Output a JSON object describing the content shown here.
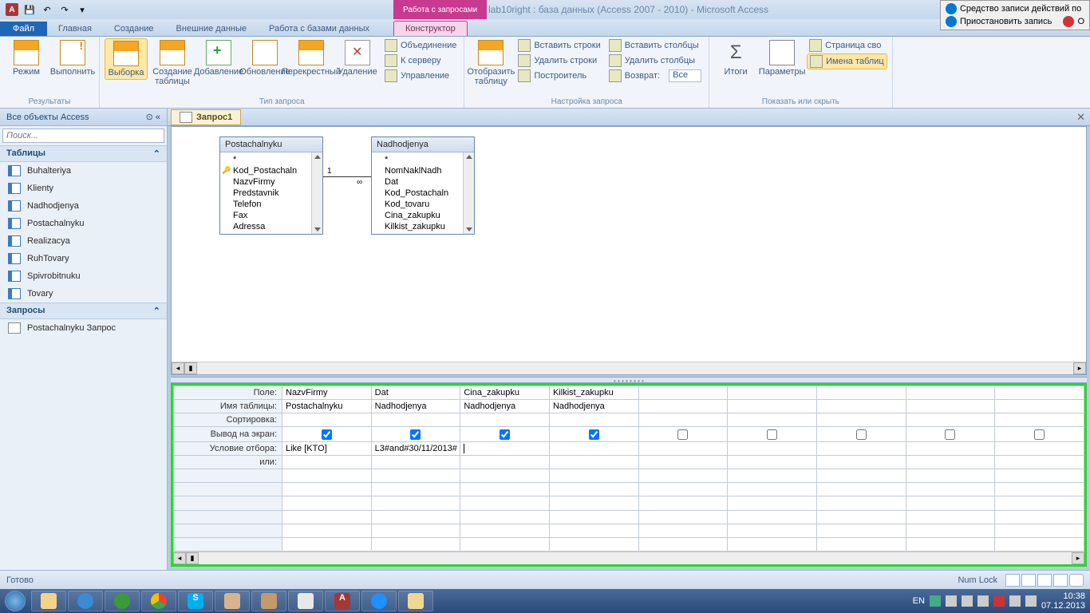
{
  "titlebar": {
    "context_title": "Работа с запросами",
    "db_title": "lab10right : база данных (Access 2007 - 2010)  -  Microsoft Access"
  },
  "recorder": {
    "line1": "Средство записи действий по",
    "line2": "Приостановить запись",
    "stop": "О"
  },
  "tabs": {
    "file": "Файл",
    "home": "Главная",
    "create": "Создание",
    "external": "Внешние данные",
    "dbtools": "Работа с базами данных",
    "design": "Конструктор"
  },
  "ribbon": {
    "results": {
      "view": "Режим",
      "run": "Выполнить",
      "label": "Результаты"
    },
    "query_type": {
      "select": "Выборка",
      "make_table": "Создание\nтаблицы",
      "append": "Добавление",
      "update": "Обновление",
      "crosstab": "Перекрестный",
      "delete": "Удаление",
      "union": "Объединение",
      "passthrough": "К серверу",
      "datadef": "Управление",
      "label": "Тип запроса"
    },
    "setup": {
      "show_table": "Отобразить\nтаблицу",
      "insert_rows": "Вставить строки",
      "delete_rows": "Удалить строки",
      "builder": "Построитель",
      "insert_cols": "Вставить столбцы",
      "delete_cols": "Удалить столбцы",
      "return_label": "Возврат:",
      "return_value": "Все",
      "label": "Настройка запроса"
    },
    "show_hide": {
      "totals": "Итоги",
      "params": "Параметры",
      "propsheet": "Страница сво",
      "tablenames": "Имена таблиц",
      "label": "Показать или скрыть"
    }
  },
  "nav": {
    "header": "Все объекты Access",
    "search_placeholder": "Поиск...",
    "tables_section": "Таблицы",
    "tables": [
      "Buhalteriya",
      "Klienty",
      "Nadhodjenya",
      "Postachalnyku",
      "Realizacya",
      "RuhTovary",
      "Spivrobitnuku",
      "Tovary"
    ],
    "queries_section": "Запросы",
    "queries": [
      "Postachalnyku Запрос"
    ]
  },
  "doc": {
    "tab_name": "Запрос1"
  },
  "field_lists": {
    "t1": {
      "name": "Postachalnyku",
      "fields": [
        "*",
        "Kod_Postachaln",
        "NazvFirmy",
        "Predstavnik",
        "Telefon",
        "Fax",
        "Adressa"
      ]
    },
    "t2": {
      "name": "Nadhodjenya",
      "fields": [
        "*",
        "NomNaklNadh",
        "Dat",
        "Kod_Postachaln",
        "Kod_tovaru",
        "Cina_zakupku",
        "Kilkist_zakupku"
      ]
    }
  },
  "qbe": {
    "row_labels": {
      "field": "Поле:",
      "table": "Имя таблицы:",
      "sort": "Сортировка:",
      "show": "Вывод на экран:",
      "criteria": "Условие отбора:",
      "or": "или:"
    },
    "cols": [
      {
        "field": "NazvFirmy",
        "table": "Postachalnyku",
        "show": true,
        "criteria": "Like [KTO]"
      },
      {
        "field": "Dat",
        "table": "Nadhodjenya",
        "show": true,
        "criteria": "L3#and#30/11/2013#"
      },
      {
        "field": "Cina_zakupku",
        "table": "Nadhodjenya",
        "show": true,
        "criteria": ""
      },
      {
        "field": "Kilkist_zakupku",
        "table": "Nadhodjenya",
        "show": true,
        "criteria": ""
      },
      {
        "field": "",
        "table": "",
        "show": false,
        "criteria": ""
      },
      {
        "field": "",
        "table": "",
        "show": false,
        "criteria": ""
      },
      {
        "field": "",
        "table": "",
        "show": false,
        "criteria": ""
      },
      {
        "field": "",
        "table": "",
        "show": false,
        "criteria": ""
      },
      {
        "field": "",
        "table": "",
        "show": false,
        "criteria": ""
      }
    ]
  },
  "status": {
    "ready": "Готово",
    "numlock": "Num Lock"
  },
  "tray": {
    "lang": "EN",
    "time": "10:38",
    "date": "07.12.2013"
  }
}
